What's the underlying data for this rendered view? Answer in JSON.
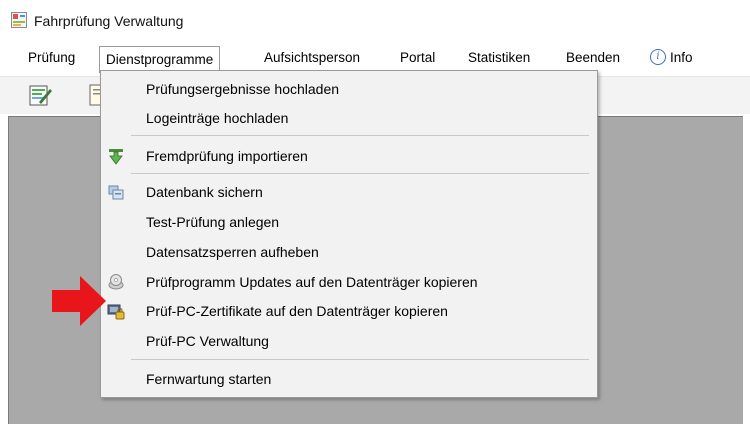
{
  "window": {
    "title": "Fahrprüfung Verwaltung"
  },
  "menubar": {
    "items": [
      {
        "label": "Prüfung"
      },
      {
        "label": "Dienstprogramme"
      },
      {
        "label": "Aufsichtsperson"
      },
      {
        "label": "Portal"
      },
      {
        "label": "Statistiken"
      },
      {
        "label": "Beenden"
      },
      {
        "label": "Info",
        "icon": "info-icon"
      }
    ]
  },
  "toolbar": {
    "buttons": [
      {
        "icon": "edit-form-icon"
      },
      {
        "icon": "document-icon"
      }
    ]
  },
  "dropdown": {
    "items": [
      {
        "label": "Prüfungsergebnisse hochladen",
        "icon": null
      },
      {
        "label": "Logeinträge hochladen",
        "icon": null
      },
      {
        "label": "Fremdprüfung importieren",
        "icon": "import-arrow-icon"
      },
      {
        "label": "Datenbank sichern",
        "icon": "database-backup-icon"
      },
      {
        "label": "Test-Prüfung anlegen",
        "icon": null
      },
      {
        "label": "Datensatzsperren aufheben",
        "icon": null
      },
      {
        "label": "Prüfprogramm Updates auf den Datenträger kopieren",
        "icon": "disc-icon"
      },
      {
        "label": "Prüf-PC-Zertifikate auf den Datenträger kopieren",
        "icon": "certificate-lock-icon"
      },
      {
        "label": "Prüf-PC Verwaltung",
        "icon": null
      },
      {
        "label": "Fernwartung starten",
        "icon": null
      }
    ]
  },
  "colors": {
    "highlight_arrow": "#e8151b",
    "workspace": "#a9a9a9",
    "menu_bg": "#f2f2f2"
  }
}
